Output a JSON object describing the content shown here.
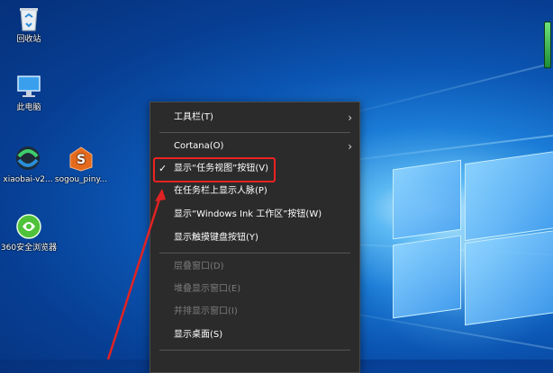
{
  "desktop": {
    "icons": [
      {
        "label": "回收站",
        "icon": "recycle-bin-icon"
      },
      {
        "label": "此电脑",
        "icon": "computer-icon"
      },
      {
        "label": "xiaobai-v2...",
        "icon": "xiaobai-icon"
      },
      {
        "label": "sogou_piny...",
        "icon": "sogou-icon"
      },
      {
        "label": "360安全浏览器",
        "icon": "360-browser-icon"
      }
    ]
  },
  "context_menu": {
    "items": [
      {
        "label": "工具栏(T)",
        "submenu": true,
        "enabled": true
      },
      {
        "label": "Cortana(O)",
        "submenu": true,
        "enabled": true
      },
      {
        "label": "显示“任务视图”按钮(V)",
        "checked": true,
        "enabled": true,
        "highlighted": true
      },
      {
        "label": "在任务栏上显示人脉(P)",
        "enabled": true
      },
      {
        "label": "显示“Windows Ink 工作区”按钮(W)",
        "enabled": true
      },
      {
        "label": "显示触摸键盘按钮(Y)",
        "enabled": true
      },
      {
        "label": "层叠窗口(D)",
        "enabled": false
      },
      {
        "label": "堆叠显示窗口(E)",
        "enabled": false
      },
      {
        "label": "并排显示窗口(I)",
        "enabled": false
      },
      {
        "label": "显示桌面(S)",
        "enabled": true
      }
    ],
    "check_glyph": "✓",
    "chevron_glyph": "›"
  },
  "colors": {
    "highlight_box": "#e22222",
    "annotation_arrow": "#e22222",
    "menu_bg": "#2b2b2b"
  }
}
